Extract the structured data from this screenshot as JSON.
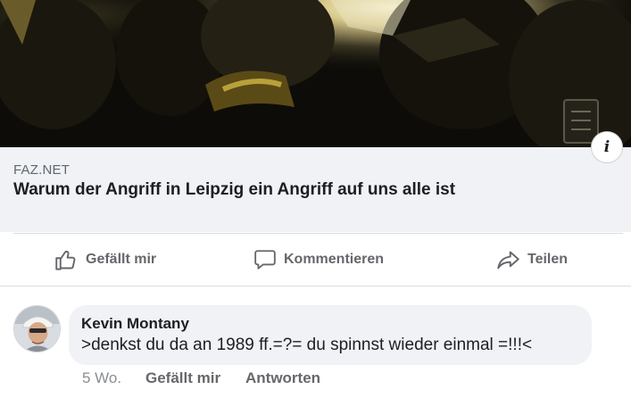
{
  "link_preview": {
    "source": "FAZ.NET",
    "headline": "Warum der Angriff in Leipzig ein Angriff auf uns alle ist",
    "image_icon": "photo-police-helmets"
  },
  "info_button": {
    "glyph": "i",
    "icon": "info-icon"
  },
  "actions": {
    "like_label": "Gefällt mir",
    "comment_label": "Kommentieren",
    "share_label": "Teilen",
    "like_icon": "thumbs-up-icon",
    "comment_icon": "speech-bubble-icon",
    "share_icon": "share-arrow-icon"
  },
  "comment": {
    "author": "Kevin Montany",
    "text": ">denkst du da an 1989 ff.=?= du spinnst wieder einmal =!!!<",
    "time": "5 Wo.",
    "like_label": "Gefällt mir",
    "reply_label": "Antworten"
  },
  "colors": {
    "card_background": "#f0f2f5",
    "text_primary": "#1c1e21",
    "text_secondary": "#65676b"
  }
}
